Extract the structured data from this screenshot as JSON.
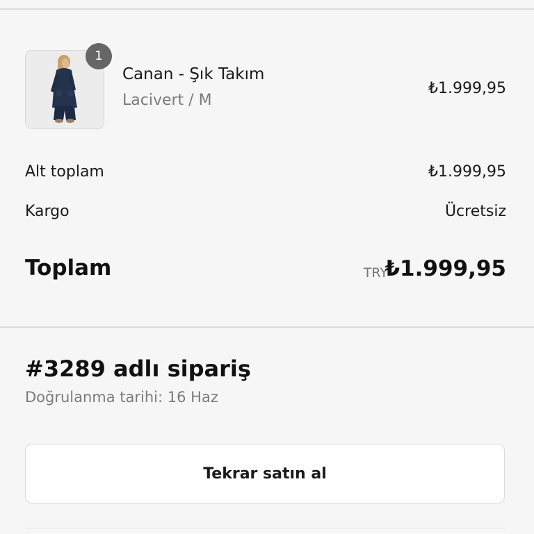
{
  "cart": {
    "items": [
      {
        "quantity": "1",
        "name": "Canan - Şık Takım",
        "variant": "Lacivert / M",
        "price": "₺1.999,95",
        "image": "product-photo-icon"
      }
    ]
  },
  "summary": {
    "subtotal_label": "Alt toplam",
    "subtotal_value": "₺1.999,95",
    "shipping_label": "Kargo",
    "shipping_value": "Ücretsiz",
    "total_label": "Toplam",
    "currency_code": "TRY",
    "total_value": "₺1.999,95"
  },
  "order": {
    "title": "#3289 adlı sipariş",
    "date": "Doğrulanma tarihi: 16 Haz"
  },
  "actions": {
    "rebuy_label": "Tekrar satın al"
  },
  "colors": {
    "background": "#f6f6f6",
    "badge": "#666666",
    "product_navy": "#23324d"
  }
}
